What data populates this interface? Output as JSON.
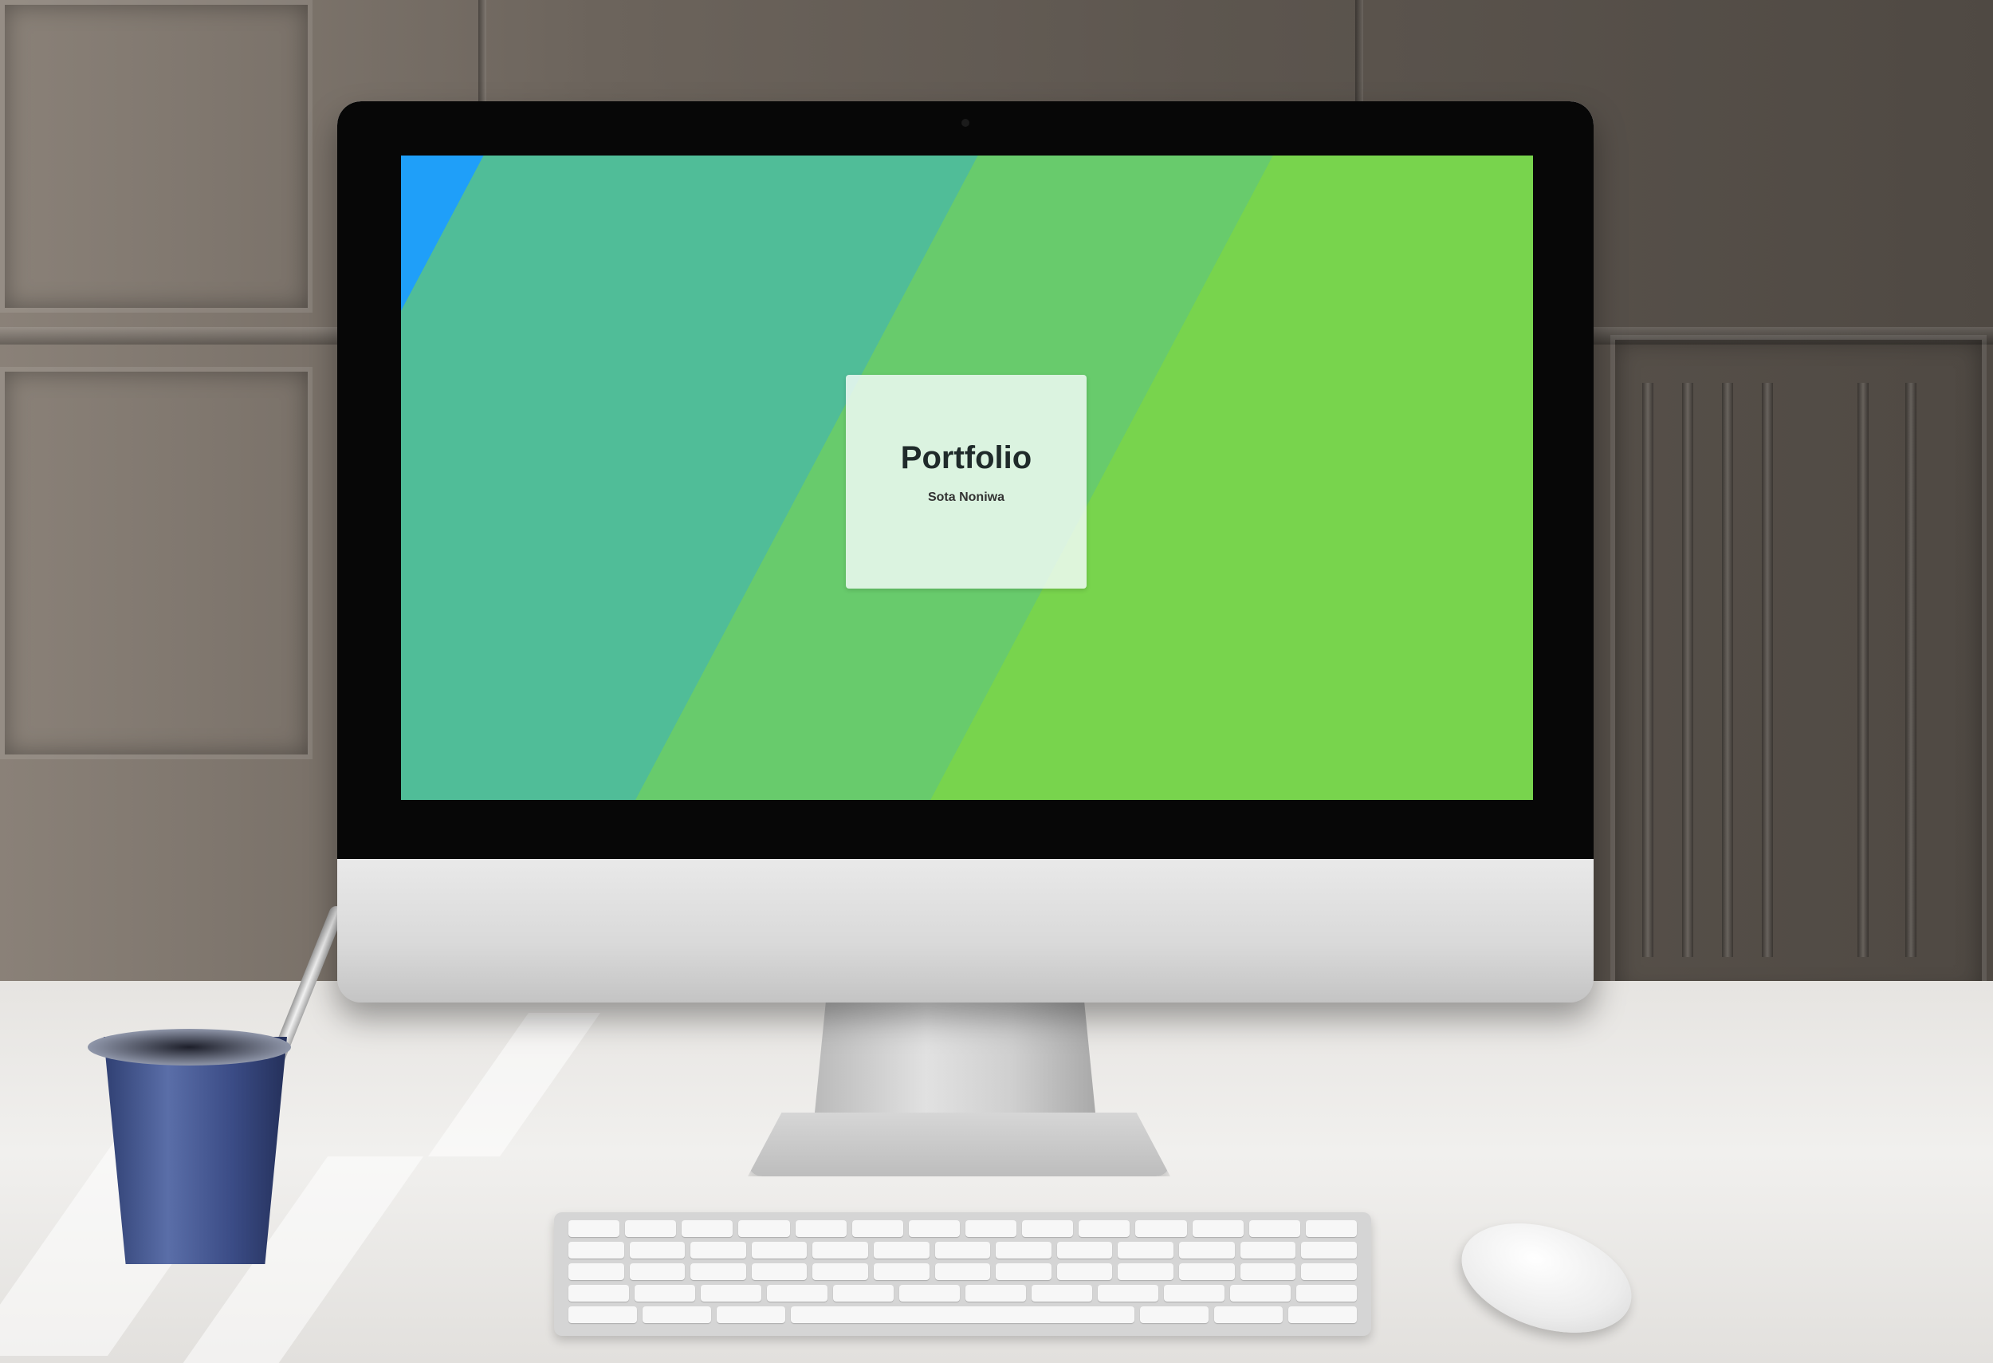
{
  "screen": {
    "card": {
      "title": "Portfolio",
      "subtitle": "Sota Noniwa"
    },
    "colors": {
      "blue": "#1f9ff9",
      "teal": "#50bd98",
      "green": "#68cb6c",
      "lime": "#78d44d"
    }
  },
  "objects": {
    "desktop_computer": "imac-style-monitor",
    "keyboard": "wireless-keyboard",
    "mouse": "wireless-mouse",
    "cup": "blue-metal-cup-with-spoon"
  }
}
